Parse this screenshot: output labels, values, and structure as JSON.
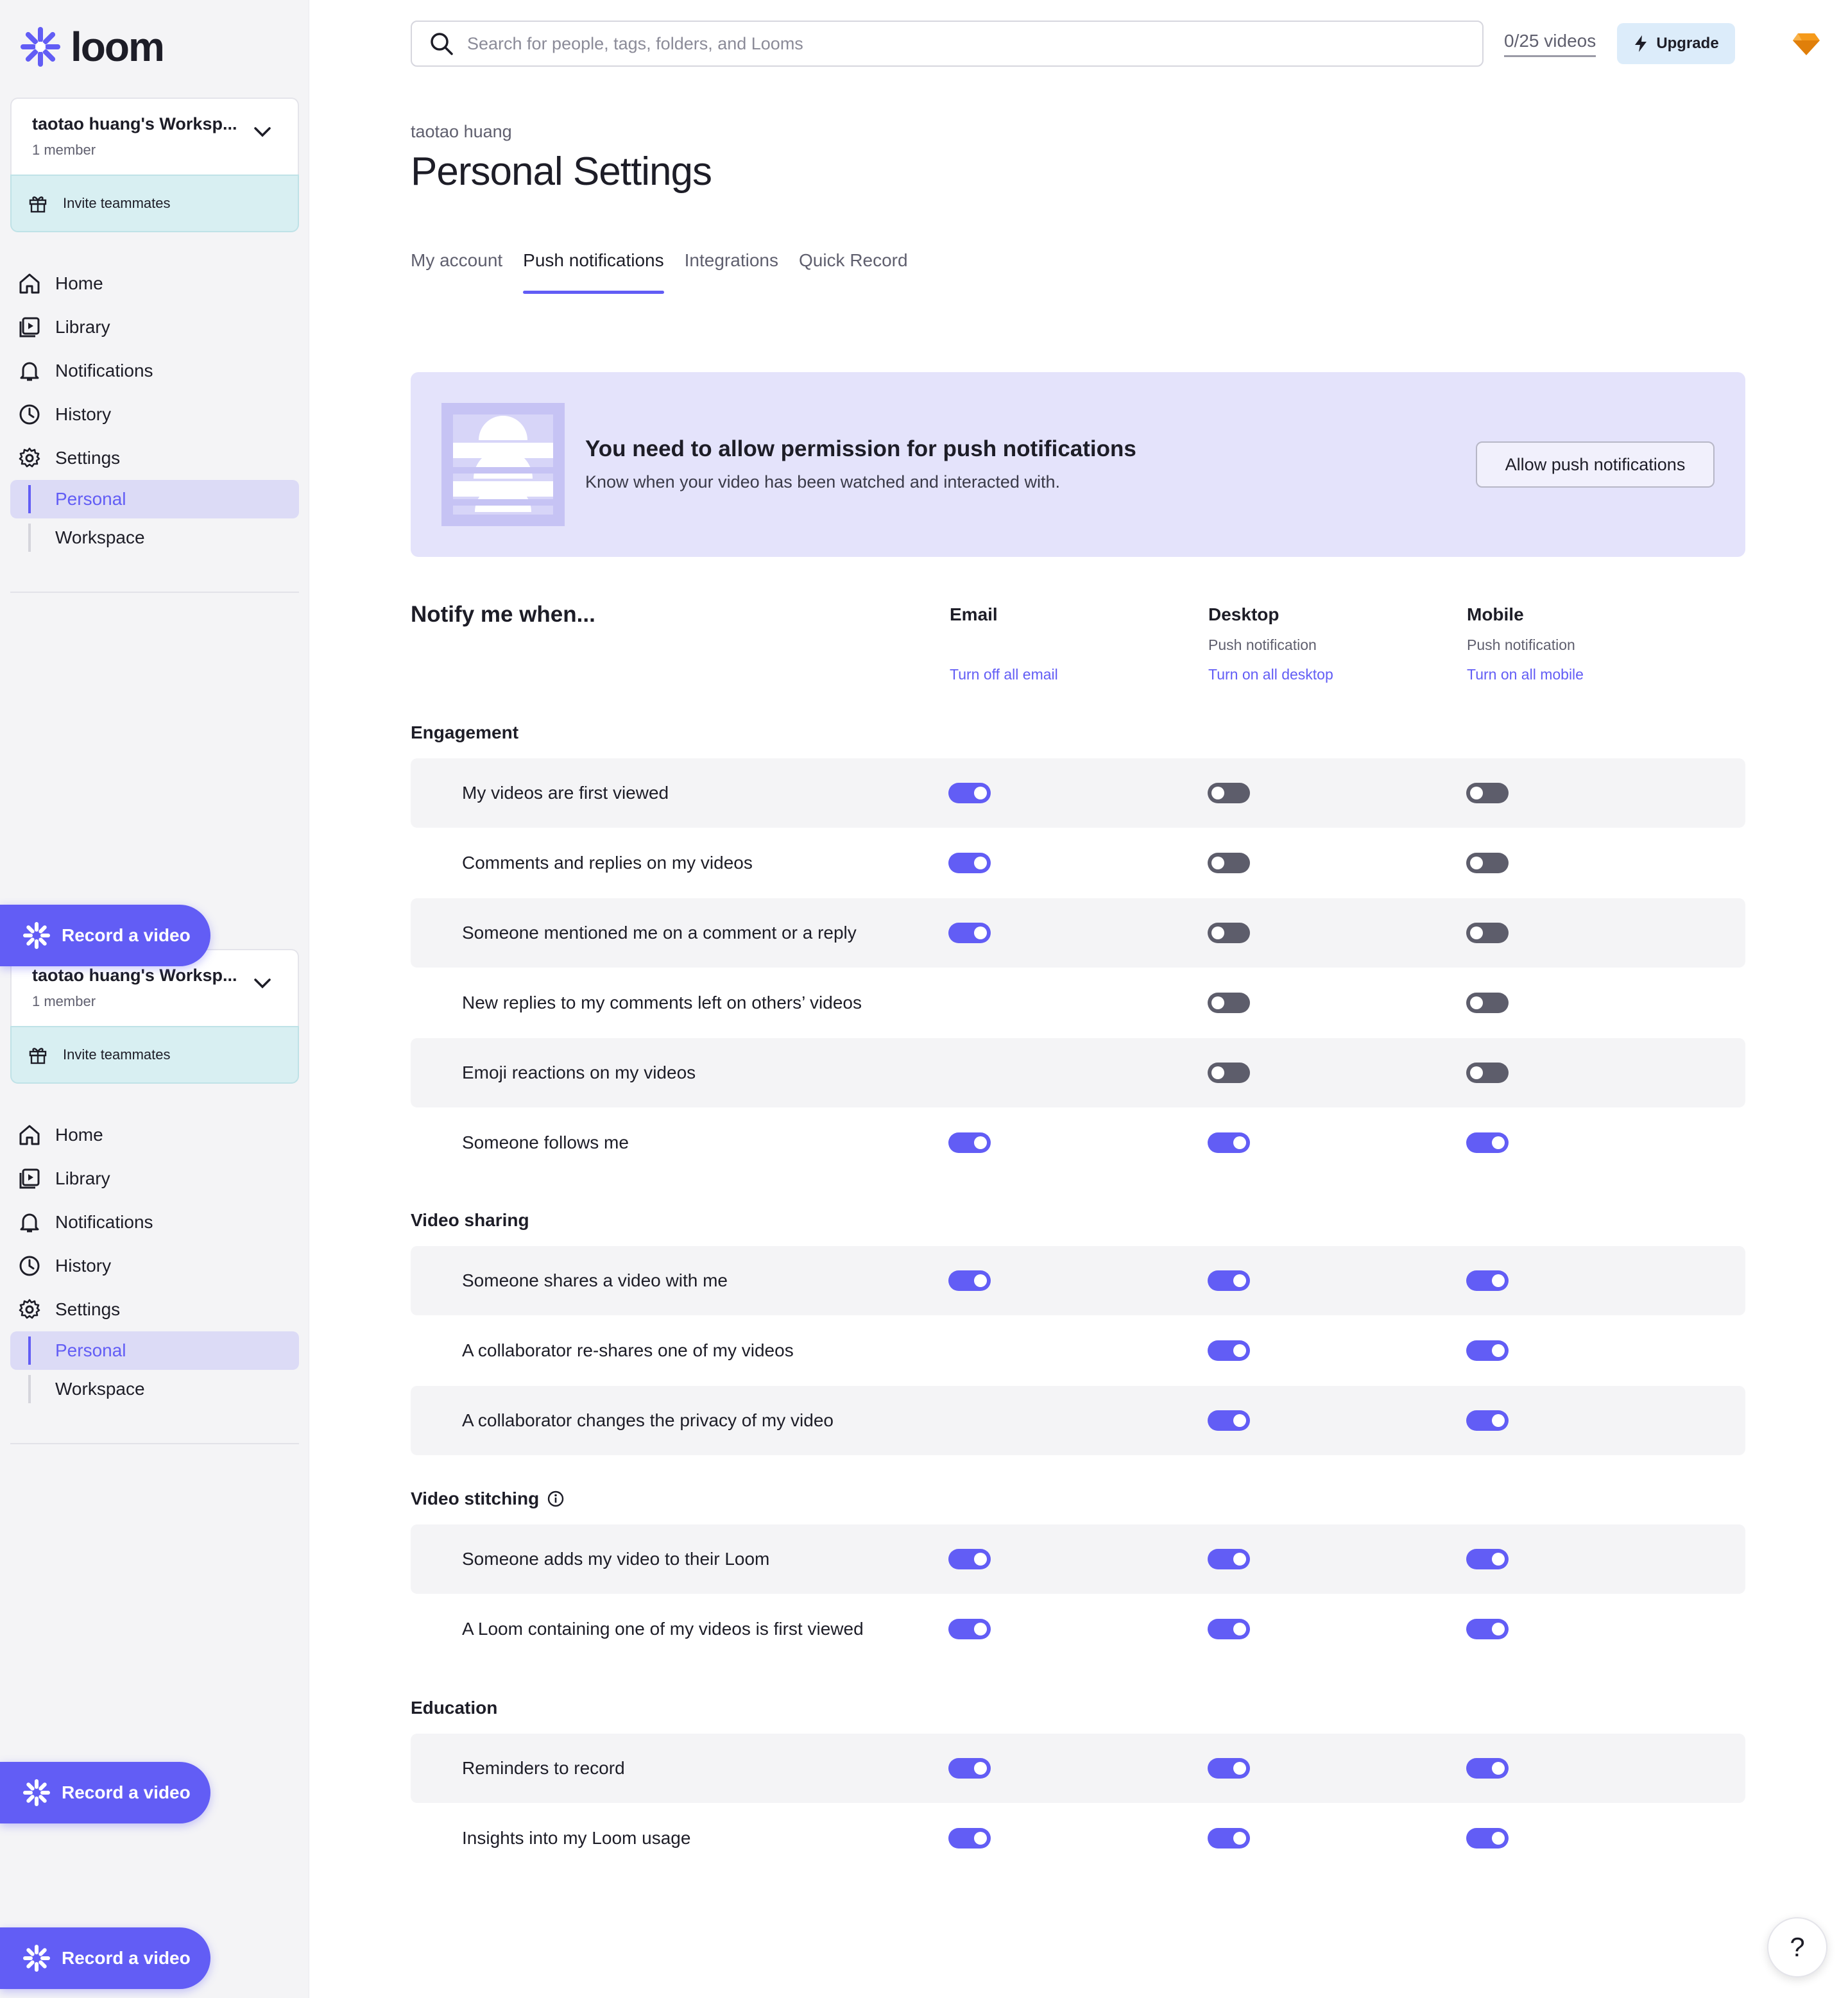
{
  "brand": {
    "name": "loom",
    "accent": "#625df5"
  },
  "workspace": {
    "name": "taotao huang's Worksp...",
    "members": "1 member",
    "invite": "Invite teammates"
  },
  "nav": {
    "home": "Home",
    "library": "Library",
    "notifications": "Notifications",
    "history": "History",
    "settings": "Settings",
    "personal": "Personal",
    "workspace": "Workspace"
  },
  "record": "Record a video",
  "search": {
    "placeholder": "Search for people, tags, folders, and Looms"
  },
  "video_count": "0/25 videos",
  "upgrade": "Upgrade",
  "header": {
    "owner": "taotao huang",
    "title": "Personal Settings"
  },
  "tabs": [
    "My account",
    "Push notifications",
    "Integrations",
    "Quick Record"
  ],
  "active_tab": "Push notifications",
  "banner": {
    "title": "You need to allow permission for push notifications",
    "subtitle": "Know when your video has been watched and interacted with.",
    "button": "Allow push notifications"
  },
  "table": {
    "heading": "Notify me when...",
    "columns": [
      {
        "title": "Email",
        "subtitle": "",
        "link": "Turn off all email"
      },
      {
        "title": "Desktop",
        "subtitle": "Push notification",
        "link": "Turn on all desktop"
      },
      {
        "title": "Mobile",
        "subtitle": "Push notification",
        "link": "Turn on all mobile"
      }
    ],
    "sections": [
      {
        "title": "Engagement",
        "rows": [
          {
            "label": "My videos are first viewed",
            "email": true,
            "desktop": false,
            "mobile": false
          },
          {
            "label": "Comments and replies on my videos",
            "email": true,
            "desktop": false,
            "mobile": false
          },
          {
            "label": "Someone mentioned me on a comment or a reply",
            "email": true,
            "desktop": false,
            "mobile": false
          },
          {
            "label": "New replies to my comments left on others’ videos",
            "email": null,
            "desktop": false,
            "mobile": false
          },
          {
            "label": "Emoji reactions on my videos",
            "email": null,
            "desktop": false,
            "mobile": false
          },
          {
            "label": "Someone follows me",
            "email": true,
            "desktop": true,
            "mobile": true
          }
        ]
      },
      {
        "title": "Video sharing",
        "rows": [
          {
            "label": "Someone shares a video with me",
            "email": true,
            "desktop": true,
            "mobile": true
          },
          {
            "label": "A collaborator re-shares one of my videos",
            "email": null,
            "desktop": true,
            "mobile": true
          },
          {
            "label": "A collaborator changes the privacy of my video",
            "email": null,
            "desktop": true,
            "mobile": true
          }
        ]
      },
      {
        "title": "Video stitching",
        "rows": [
          {
            "label": "Someone adds my video to their Loom",
            "email": true,
            "desktop": true,
            "mobile": true
          },
          {
            "label": "A Loom containing one of my videos is first viewed",
            "email": true,
            "desktop": true,
            "mobile": true
          }
        ]
      },
      {
        "title": "Education",
        "rows": [
          {
            "label": "Reminders to record",
            "email": true,
            "desktop": true,
            "mobile": true
          },
          {
            "label": "Insights into my Loom usage",
            "email": true,
            "desktop": true,
            "mobile": true
          }
        ]
      }
    ]
  },
  "help": "?"
}
